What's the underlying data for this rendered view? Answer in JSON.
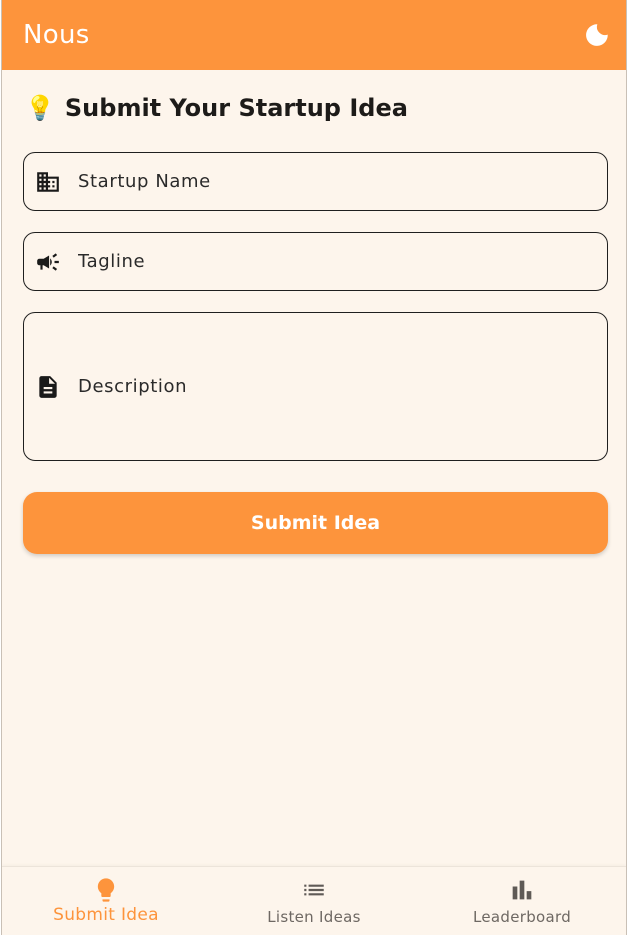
{
  "app": {
    "title": "Nous",
    "theme_toggle_icon": "moon-icon"
  },
  "form": {
    "heading_emoji": "💡",
    "heading": "Submit Your Startup Idea",
    "fields": {
      "startup_name": {
        "placeholder": "Startup Name",
        "value": "",
        "icon": "building-icon"
      },
      "tagline": {
        "placeholder": "Tagline",
        "value": "",
        "icon": "megaphone-icon"
      },
      "description": {
        "placeholder": "Description",
        "value": "",
        "icon": "document-icon"
      }
    },
    "submit_label": "Submit Idea"
  },
  "bottom_nav": {
    "items": [
      {
        "label": "Submit Idea",
        "icon": "lightbulb-icon",
        "active": true
      },
      {
        "label": "Listen Ideas",
        "icon": "list-icon",
        "active": false
      },
      {
        "label": "Leaderboard",
        "icon": "bar-chart-icon",
        "active": false
      }
    ]
  },
  "colors": {
    "accent": "#fd943c",
    "background": "#fdf5ec",
    "text": "#1d1b19",
    "inactive_nav": "#6e6863"
  }
}
